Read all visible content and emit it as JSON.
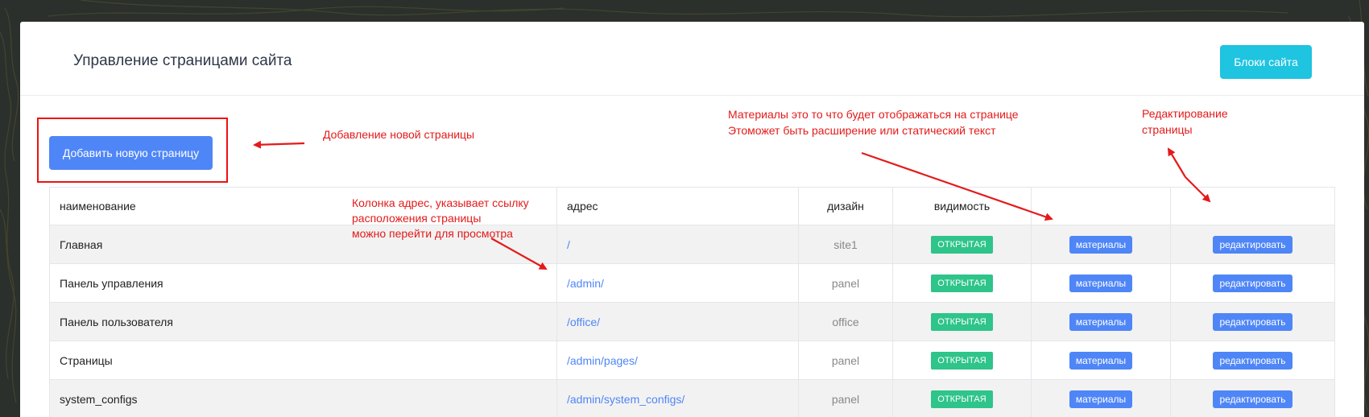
{
  "header": {
    "title": "Управление страницами сайта",
    "blocks_button": "Блоки сайта"
  },
  "toolbar": {
    "add_button": "Добавить новую страницу"
  },
  "table": {
    "columns": {
      "name": "наименование",
      "address": "адрес",
      "design": "дизайн",
      "visibility": "видимость"
    },
    "rows": [
      {
        "name": "Главная",
        "address": "/",
        "design": "site1",
        "visibility": "ОТКРЫТАЯ",
        "materials": "материалы",
        "edit": "редактировать"
      },
      {
        "name": "Панель управления",
        "address": "/admin/",
        "design": "panel",
        "visibility": "ОТКРЫТАЯ",
        "materials": "материалы",
        "edit": "редактировать"
      },
      {
        "name": "Панель пользователя",
        "address": "/office/",
        "design": "office",
        "visibility": "ОТКРЫТАЯ",
        "materials": "материалы",
        "edit": "редактировать"
      },
      {
        "name": "Страницы",
        "address": "/admin/pages/",
        "design": "panel",
        "visibility": "ОТКРЫТАЯ",
        "materials": "материалы",
        "edit": "редактировать"
      },
      {
        "name": "system_configs",
        "address": "/admin/system_configs/",
        "design": "panel",
        "visibility": "ОТКРЫТАЯ",
        "materials": "материалы",
        "edit": "редактировать"
      }
    ]
  },
  "annotations": {
    "add_page": "Добавление новой страницы",
    "address_col": [
      "Колонка адрес, указывает ссылку",
      "расположения страницы",
      "можно перейти для просмотра"
    ],
    "materials": [
      "Материалы это то что будет отображаться на странице",
      "Этоможет быть расширение или статический текст"
    ],
    "edit": [
      "Редактирование",
      "страницы"
    ]
  },
  "colors": {
    "accent_blue": "#4f86f7",
    "cyan": "#1ec4e0",
    "badge_green": "#2ec48a",
    "annotation_red": "#e41a1a",
    "background": "#2b302c"
  }
}
